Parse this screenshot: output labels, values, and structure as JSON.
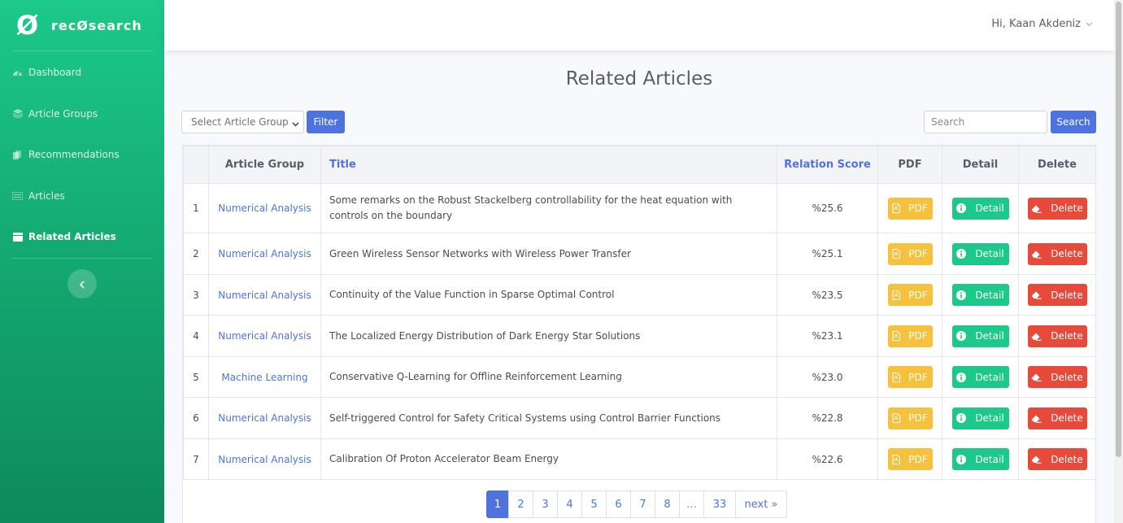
{
  "brand": {
    "logo": "Ø",
    "name": "recØsearch"
  },
  "sidebar": {
    "items": [
      {
        "label": "Dashboard",
        "icon": "dashboard-icon"
      },
      {
        "label": "Article Groups",
        "icon": "layers-icon"
      },
      {
        "label": "Recommendations",
        "icon": "copy-icon"
      },
      {
        "label": "Articles",
        "icon": "list-icon"
      },
      {
        "label": "Related Articles",
        "icon": "table-icon",
        "active": true
      }
    ]
  },
  "topbar": {
    "greeting": "Hi, Kaan Akdeniz"
  },
  "page": {
    "title": "Related Articles"
  },
  "filters": {
    "select_value": "Select Article Group",
    "filter_label": "Filter",
    "search_placeholder": "Search",
    "search_label": "Search"
  },
  "table": {
    "headers": [
      "",
      "Article Group",
      "Title",
      "Relation Score",
      "PDF",
      "Detail",
      "Delete"
    ],
    "pdf_label": "PDF",
    "detail_label": "Detail",
    "delete_label": "Delete",
    "rows": [
      {
        "num": "1",
        "group": "Numerical Analysis",
        "title": "Some remarks on the Robust Stackelberg controllability for the heat equation with controls on the boundary",
        "score": "%25.6"
      },
      {
        "num": "2",
        "group": "Numerical Analysis",
        "title": "Green Wireless Sensor Networks with Wireless Power Transfer",
        "score": "%25.1"
      },
      {
        "num": "3",
        "group": "Numerical Analysis",
        "title": "Continuity of the Value Function in Sparse Optimal Control",
        "score": "%23.5"
      },
      {
        "num": "4",
        "group": "Numerical Analysis",
        "title": "The Localized Energy Distribution of Dark Energy Star Solutions",
        "score": "%23.1"
      },
      {
        "num": "5",
        "group": "Machine Learning",
        "title": "Conservative Q-Learning for Offline Reinforcement Learning",
        "score": "%23.0"
      },
      {
        "num": "6",
        "group": "Numerical Analysis",
        "title": "Self-triggered Control for Safety Critical Systems using Control Barrier Functions",
        "score": "%22.8"
      },
      {
        "num": "7",
        "group": "Numerical Analysis",
        "title": "Calibration Of Proton Accelerator Beam Energy",
        "score": "%22.6"
      }
    ]
  },
  "pagination": {
    "pages": [
      "1",
      "2",
      "3",
      "4",
      "5",
      "6",
      "7",
      "8",
      "…",
      "33"
    ],
    "next": "next »",
    "current": "1"
  },
  "colors": {
    "primary": "#4e73df",
    "success": "#1cc88a",
    "warning": "#f6c23e",
    "danger": "#e74a3b"
  }
}
